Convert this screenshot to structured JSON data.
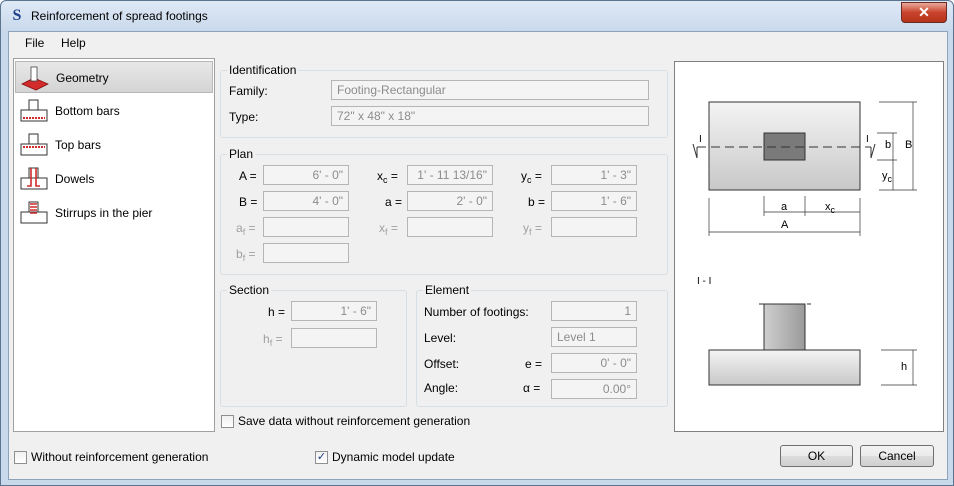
{
  "window": {
    "title": "Reinforcement of spread footings",
    "app_icon": "S",
    "close": "✕"
  },
  "menu": {
    "file": "File",
    "help": "Help"
  },
  "nav": {
    "items": [
      {
        "label": "Geometry",
        "icon": "geometry-icon"
      },
      {
        "label": "Bottom bars",
        "icon": "bottom-bars-icon"
      },
      {
        "label": "Top bars",
        "icon": "top-bars-icon"
      },
      {
        "label": "Dowels",
        "icon": "dowels-icon"
      },
      {
        "label": "Stirrups in the pier",
        "icon": "stirrups-icon"
      }
    ]
  },
  "identification": {
    "legend": "Identification",
    "family_label": "Family:",
    "family_value": "Footing-Rectangular",
    "type_label": "Type:",
    "type_value": "72\" x 48\" x 18\""
  },
  "plan": {
    "legend": "Plan",
    "A_label": "A =",
    "A_value": "6' - 0\"",
    "B_label": "B =",
    "B_value": "4' - 0\"",
    "af_label": "a",
    "af_sub": "f",
    "af_eq": "=",
    "af_value": "",
    "bf_label": "b",
    "bf_sub": "f",
    "bf_eq": "=",
    "bf_value": "",
    "xc_label": "x",
    "xc_sub": "c",
    "xc_eq": "=",
    "xc_value": "1' - 11 13/16\"",
    "a_label": "a =",
    "a_value": "2' - 0\"",
    "xf_label": "x",
    "xf_sub": "f",
    "xf_eq": "=",
    "xf_value": "",
    "yc_label": "y",
    "yc_sub": "c",
    "yc_eq": "=",
    "yc_value": "1' - 3\"",
    "b_label": "b =",
    "b_value": "1' - 6\"",
    "yf_label": "y",
    "yf_sub": "f",
    "yf_eq": "=",
    "yf_value": ""
  },
  "section": {
    "legend": "Section",
    "h_label": "h =",
    "h_value": "1' - 6\"",
    "hf_label": "h",
    "hf_sub": "f",
    "hf_eq": "=",
    "hf_value": ""
  },
  "element": {
    "legend": "Element",
    "count_label": "Number of footings:",
    "count_value": "1",
    "level_label": "Level:",
    "level_value": "Level 1",
    "offset_label": "Offset:",
    "offset_sym": "e =",
    "offset_value": "0' - 0\"",
    "angle_label": "Angle:",
    "angle_sym": "α =",
    "angle_value": "0.00°"
  },
  "options": {
    "save_without": "Save data without reinforcement generation",
    "save_without_checked": false,
    "without_generation": "Without reinforcement generation",
    "without_generation_checked": false,
    "dynamic_update": "Dynamic model update",
    "dynamic_update_checked": true
  },
  "buttons": {
    "ok": "OK",
    "cancel": "Cancel"
  },
  "diagram": {
    "section_mark": "I",
    "section_title": "I - I",
    "dim_a": "a",
    "dim_xc": "x",
    "dim_xc_sub": "c",
    "dim_A": "A",
    "dim_b": "b",
    "dim_B": "B",
    "dim_yc": "y",
    "dim_yc_sub": "c",
    "dim_h": "h"
  },
  "colors": {
    "accent_red": "#d22b2b",
    "titlebar": "#c9d9ec",
    "dialog_bg": "#f0f0f0"
  }
}
